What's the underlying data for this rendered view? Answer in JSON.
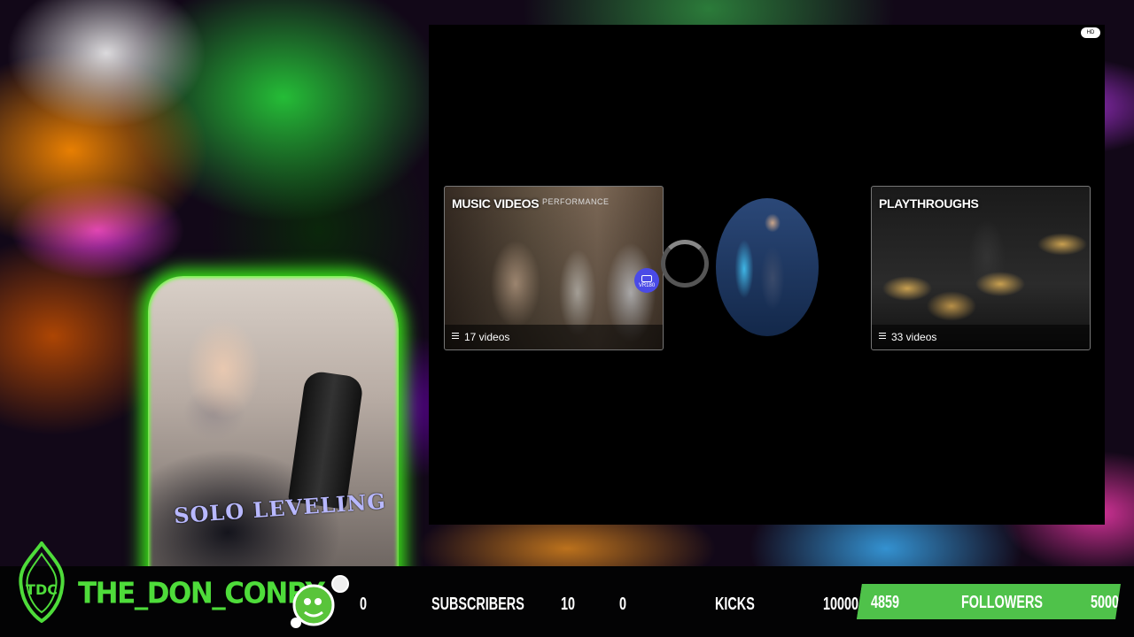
{
  "video": {
    "badge": "HD",
    "cards": [
      {
        "title": "MUSIC VIDEOS",
        "subtitle": "PERFORMANCE",
        "count": "17 videos",
        "vr_label": "VR180"
      },
      {
        "title": "PLAYTHROUGHS",
        "count": "33 videos"
      }
    ]
  },
  "webcam": {
    "shirt_text": "SOLO LEVELING"
  },
  "footer": {
    "logo_text": "TDC",
    "channel_name": "THE_DON_CONRY",
    "subscribers": {
      "current": "0",
      "label": "SUBSCRIBERS",
      "goal": "10"
    },
    "kicks": {
      "current": "0",
      "label": "KICKS",
      "goal": "10000"
    },
    "followers": {
      "current": "4859",
      "label": "FOLLOWERS",
      "goal": "5000",
      "progress": 0.9718
    },
    "accent_color": "#4edc3a"
  }
}
